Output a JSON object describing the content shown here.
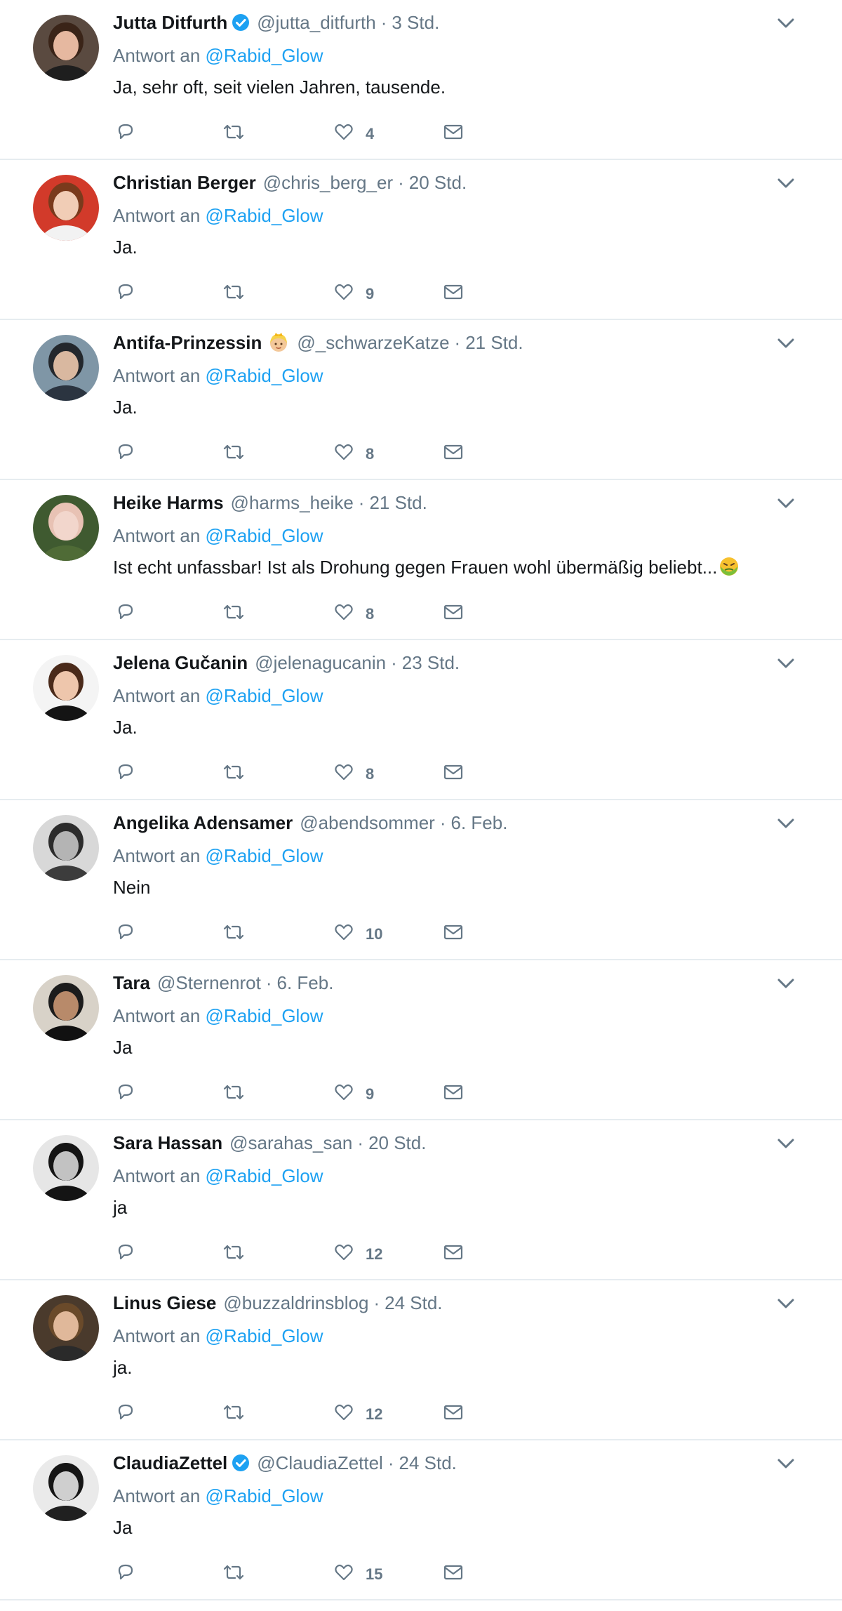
{
  "reply_prefix": "Antwort an",
  "tweets": [
    {
      "name": "Jutta Ditfurth",
      "verified": true,
      "emoji_badge": false,
      "handle": "@jutta_ditfurth",
      "time": "3 Std.",
      "reply_to": "@Rabid_Glow",
      "text": "Ja, sehr oft, seit vielen Jahren, tausende.",
      "text_emoji": false,
      "likes": "4",
      "avatar": {
        "bg": "#5a4a40",
        "skin": "#e6b8a0",
        "hair": "#3a2418",
        "shirt": "#1e1e1e"
      }
    },
    {
      "name": "Christian Berger",
      "verified": false,
      "emoji_badge": false,
      "handle": "@chris_berg_er",
      "time": "20 Std.",
      "reply_to": "@Rabid_Glow",
      "text": "Ja.",
      "text_emoji": false,
      "likes": "9",
      "avatar": {
        "bg": "#d23a2a",
        "skin": "#f1cdb6",
        "hair": "#7a3a1c",
        "shirt": "#f2f2f2"
      }
    },
    {
      "name": "Antifa-Prinzessin",
      "verified": false,
      "emoji_badge": true,
      "handle": "@_schwarzeKatze",
      "time": "21 Std.",
      "reply_to": "@Rabid_Glow",
      "text": "Ja.",
      "text_emoji": false,
      "likes": "8",
      "avatar": {
        "bg": "#7f96a6",
        "skin": "#d9b8a0",
        "hair": "#23272c",
        "shirt": "#2b3440"
      }
    },
    {
      "name": "Heike Harms",
      "verified": false,
      "emoji_badge": false,
      "handle": "@harms_heike",
      "time": "21 Std.",
      "reply_to": "@Rabid_Glow",
      "text": "Ist echt unfassbar! Ist als Drohung gegen Frauen wohl übermäßig beliebt...",
      "text_emoji": true,
      "likes": "8",
      "avatar": {
        "bg": "#3f5a30",
        "skin": "#f2d6cc",
        "hair": "#e8c2b4",
        "shirt": "#4f6b36"
      }
    },
    {
      "name": "Jelena Gučanin",
      "verified": false,
      "emoji_badge": false,
      "handle": "@jelenagucanin",
      "time": "23 Std.",
      "reply_to": "@Rabid_Glow",
      "text": "Ja.",
      "text_emoji": false,
      "likes": "8",
      "avatar": {
        "bg": "#f4f4f4",
        "skin": "#eec6ac",
        "hair": "#4a2a1a",
        "shirt": "#141414"
      }
    },
    {
      "name": "Angelika Adensamer",
      "verified": false,
      "emoji_badge": false,
      "handle": "@abendsommer",
      "time": "6. Feb.",
      "reply_to": "@Rabid_Glow",
      "text": "Nein",
      "text_emoji": false,
      "likes": "10",
      "avatar": {
        "bg": "#d8d8d8",
        "skin": "#b4b4b4",
        "hair": "#2c2c2c",
        "shirt": "#3c3c3c"
      }
    },
    {
      "name": "Tara",
      "verified": false,
      "emoji_badge": false,
      "handle": "@Sternenrot",
      "time": "6. Feb.",
      "reply_to": "@Rabid_Glow",
      "text": "Ja",
      "text_emoji": false,
      "likes": "9",
      "avatar": {
        "bg": "#d8d2c8",
        "skin": "#b88a6a",
        "hair": "#1c1c1c",
        "shirt": "#111111"
      }
    },
    {
      "name": "Sara Hassan",
      "verified": false,
      "emoji_badge": false,
      "handle": "@sarahas_san",
      "time": "20 Std.",
      "reply_to": "@Rabid_Glow",
      "text": "ja",
      "text_emoji": false,
      "likes": "12",
      "avatar": {
        "bg": "#e6e6e6",
        "skin": "#c2c2c2",
        "hair": "#141414",
        "shirt": "#141414"
      }
    },
    {
      "name": "Linus Giese",
      "verified": false,
      "emoji_badge": false,
      "handle": "@buzzaldrinsblog",
      "time": "24 Std.",
      "reply_to": "@Rabid_Glow",
      "text": "ja.",
      "text_emoji": false,
      "likes": "12",
      "avatar": {
        "bg": "#4a3a2c",
        "skin": "#e0b89a",
        "hair": "#6a4a2a",
        "shirt": "#2a2a2a"
      }
    },
    {
      "name": "ClaudiaZettel",
      "verified": true,
      "emoji_badge": false,
      "handle": "@ClaudiaZettel",
      "time": "24 Std.",
      "reply_to": "@Rabid_Glow",
      "text": "Ja",
      "text_emoji": false,
      "likes": "15",
      "avatar": {
        "bg": "#eaeaea",
        "skin": "#cfcfcf",
        "hair": "#161616",
        "shirt": "#202020"
      }
    }
  ]
}
